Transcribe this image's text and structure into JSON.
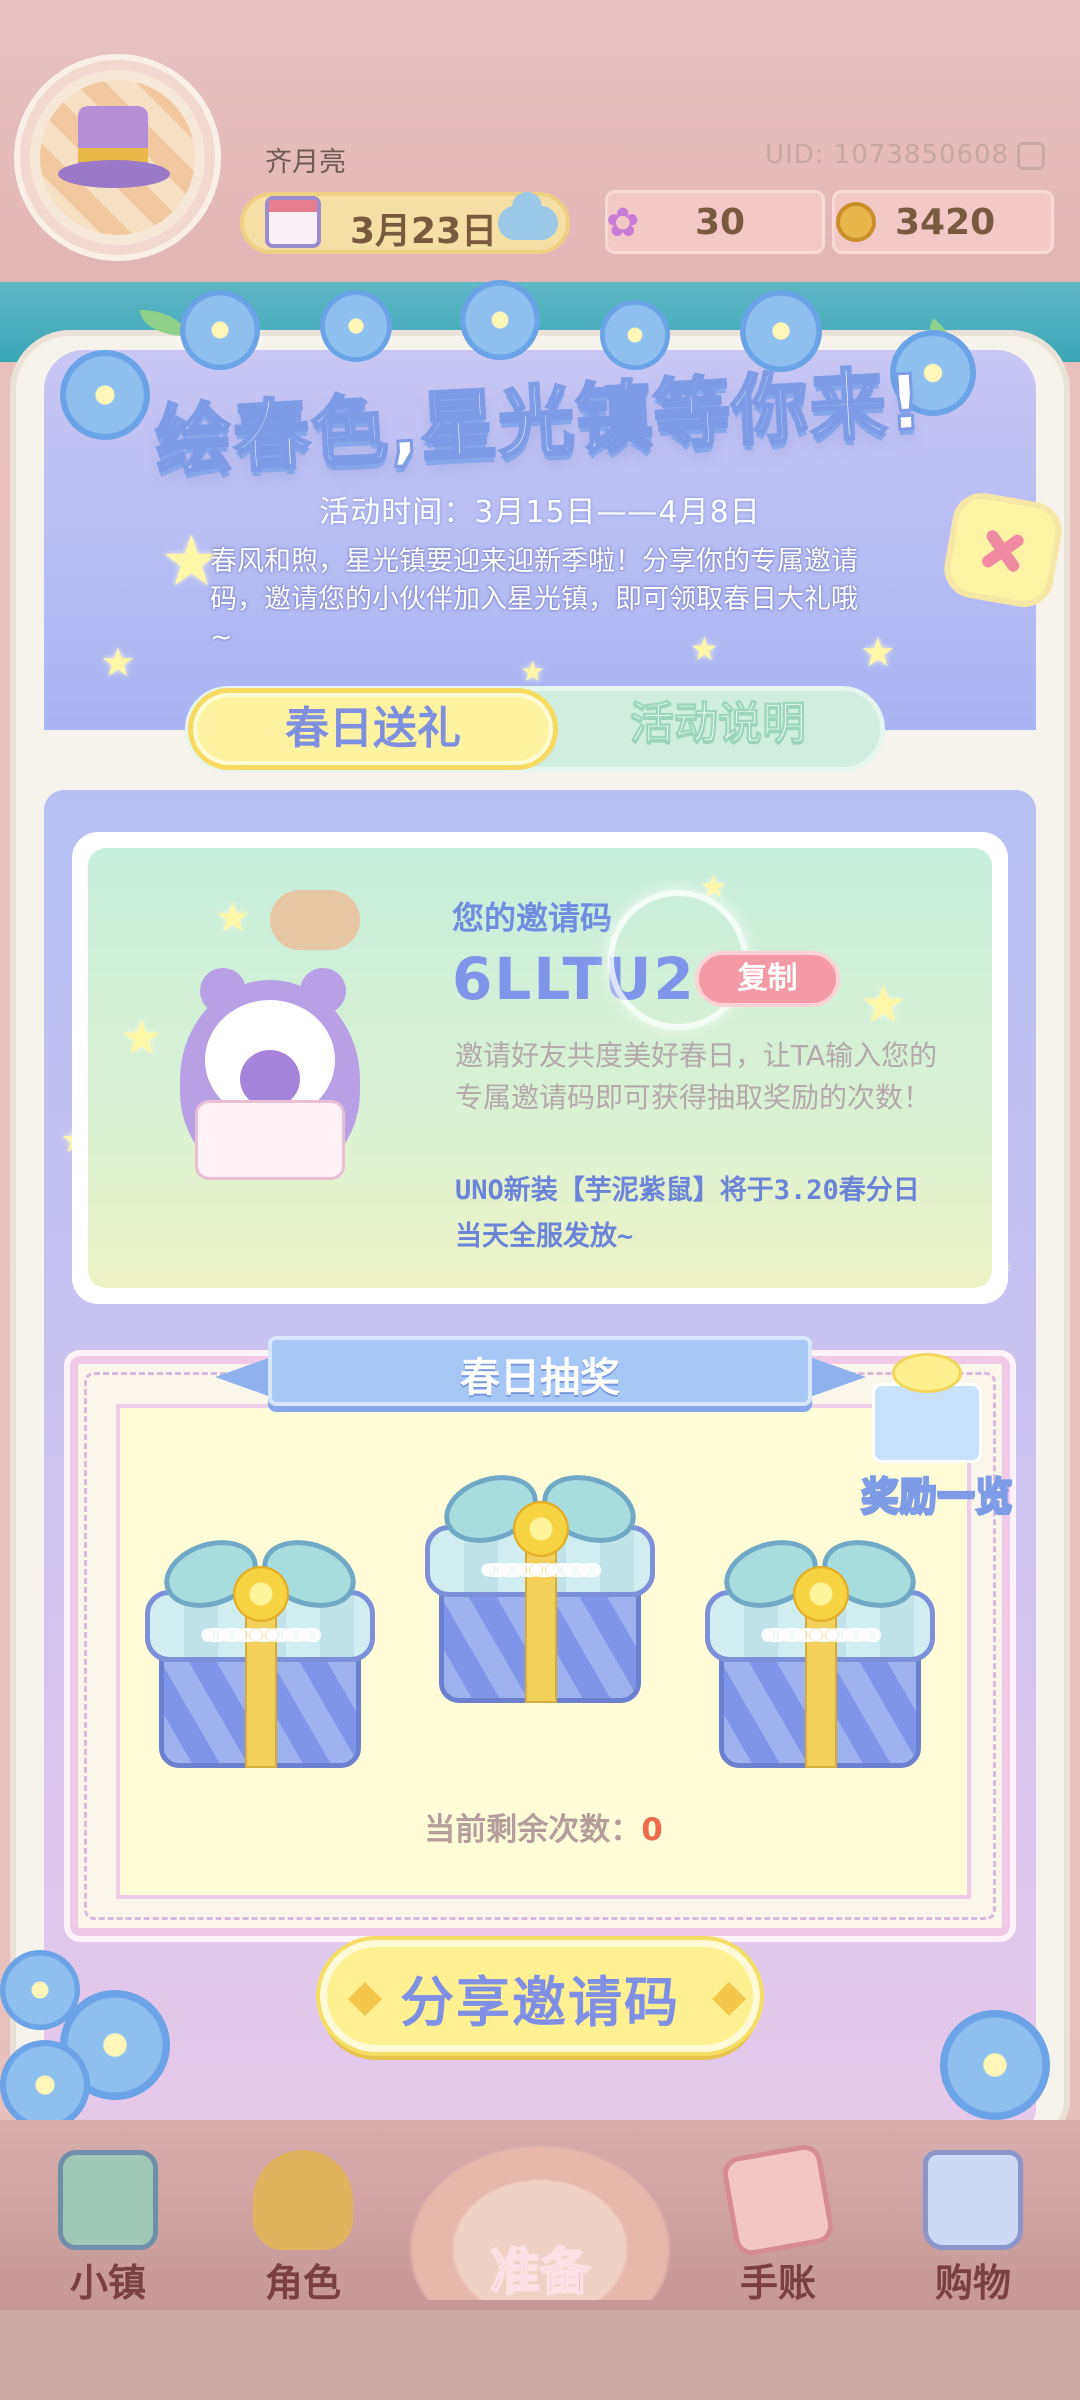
{
  "header": {
    "username": "齐月亮",
    "uid": "UID: 1073850608",
    "date": "3月23日",
    "flowers": "30",
    "coins": "3420",
    "icons": [
      "avatar-hat",
      "calendar-icon",
      "cloud-icon",
      "flower-icon",
      "coin-icon",
      "copy-icon"
    ]
  },
  "event": {
    "title": "绘春色,星光镇等你来!",
    "time": "活动时间：3月15日——4月8日",
    "intro": "春风和煦，星光镇要迎来迎新季啦！分享你的专属邀请码，邀请您的小伙伴加入星光镇，即可领取春日大礼哦~"
  },
  "tabs": {
    "active": "春日送礼",
    "inactive": "活动说明"
  },
  "invite": {
    "label": "您的邀请码",
    "code": "6LLTU2",
    "copy": "复制",
    "desc": "邀请好友共度美好春日，让TA输入您的专属邀请码即可获得抽取奖励的次数！",
    "note": "UNO新装【芋泥紫鼠】将于3.20春分日当天全服发放~"
  },
  "lottery": {
    "title": "春日抽奖",
    "reward_list": "奖励一览",
    "remaining_label": "当前剩余次数：",
    "remaining_count": "0"
  },
  "share": {
    "label": "分享邀请码"
  },
  "nav": {
    "items": [
      "小镇",
      "角色",
      "准备",
      "手账",
      "购物"
    ]
  },
  "colors": {
    "accent": "#7e8fe0",
    "tab_active_bg": "#fff3a2",
    "tab_inactive_bg": "#cfeee0",
    "copy_button": "#f49aa7",
    "remaining_count": "#ee6b4c"
  }
}
